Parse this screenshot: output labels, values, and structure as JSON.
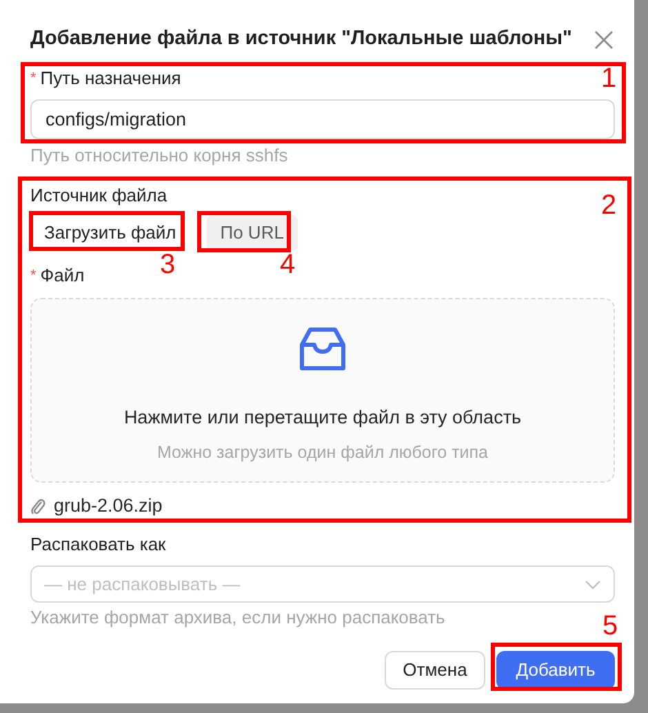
{
  "dialog": {
    "title": "Добавление файла в источник \"Локальные шаблоны\""
  },
  "destination": {
    "required_mark": "*",
    "label": "Путь назначения",
    "value": "configs/migration",
    "help": "Путь относительно корня sshfs"
  },
  "source": {
    "label": "Источник файла",
    "tabs": [
      {
        "label": "Загрузить файл",
        "selected": true
      },
      {
        "label": "По URL",
        "selected": false
      }
    ]
  },
  "file": {
    "required_mark": "*",
    "label": "Файл",
    "dropzone": {
      "title": "Нажмите или перетащите файл в эту область",
      "hint": "Можно загрузить один файл любого типа"
    },
    "attached": "grub-2.06.zip"
  },
  "unpack": {
    "label": "Распаковать как",
    "placeholder": "— не распаковывать —",
    "help": "Укажите формат архива, если нужно распаковать"
  },
  "buttons": [
    {
      "label": "Отмена",
      "kind": "default"
    },
    {
      "label": "Добавить",
      "kind": "primary"
    }
  ],
  "annotations": [
    {
      "label": "1"
    },
    {
      "label": "2"
    },
    {
      "label": "3"
    },
    {
      "label": "4"
    },
    {
      "label": "5"
    }
  ]
}
